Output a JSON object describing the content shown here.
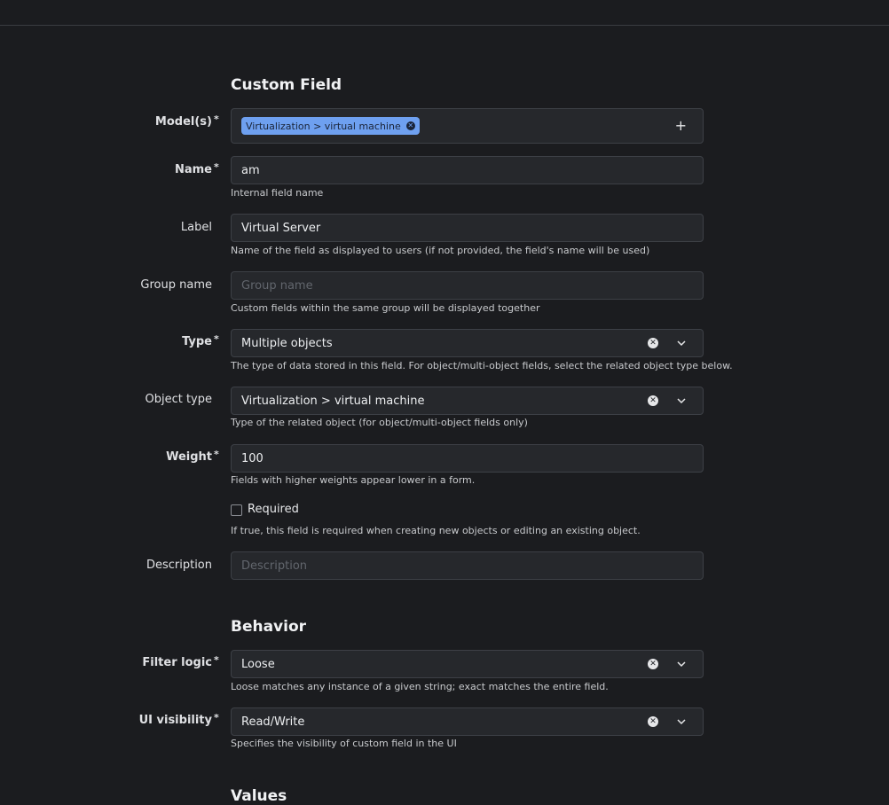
{
  "sections": {
    "custom_field": "Custom Field",
    "behavior": "Behavior",
    "values": "Values"
  },
  "required_marker": "*",
  "fields": {
    "models": {
      "label": "Model(s)",
      "tag": "Virtualization > virtual machine",
      "add_icon": "plus-icon"
    },
    "name": {
      "label": "Name",
      "value": "am",
      "help": "Internal field name"
    },
    "label": {
      "label": "Label",
      "value": "Virtual Server",
      "help": "Name of the field as displayed to users (if not provided, the field's name will be used)"
    },
    "group_name": {
      "label": "Group name",
      "placeholder": "Group name",
      "help": "Custom fields within the same group will be displayed together"
    },
    "type": {
      "label": "Type",
      "value": "Multiple objects",
      "help": "The type of data stored in this field. For object/multi-object fields, select the related object type below."
    },
    "object_type": {
      "label": "Object type",
      "value": "Virtualization > virtual machine",
      "help": "Type of the related object (for object/multi-object fields only)"
    },
    "weight": {
      "label": "Weight",
      "value": "100",
      "help": "Fields with higher weights appear lower in a form."
    },
    "required": {
      "label": "Required",
      "checked": false,
      "help": "If true, this field is required when creating new objects or editing an existing object."
    },
    "description": {
      "label": "Description",
      "placeholder": "Description"
    },
    "filter_logic": {
      "label": "Filter logic",
      "value": "Loose",
      "help": "Loose matches any instance of a given string; exact matches the entire field."
    },
    "ui_visibility": {
      "label": "UI visibility",
      "value": "Read/Write",
      "help": "Specifies the visibility of custom field in the UI"
    }
  },
  "colors": {
    "background": "#1b1c1f",
    "input_background": "#26282c",
    "tag_background": "#6ea0f0"
  }
}
